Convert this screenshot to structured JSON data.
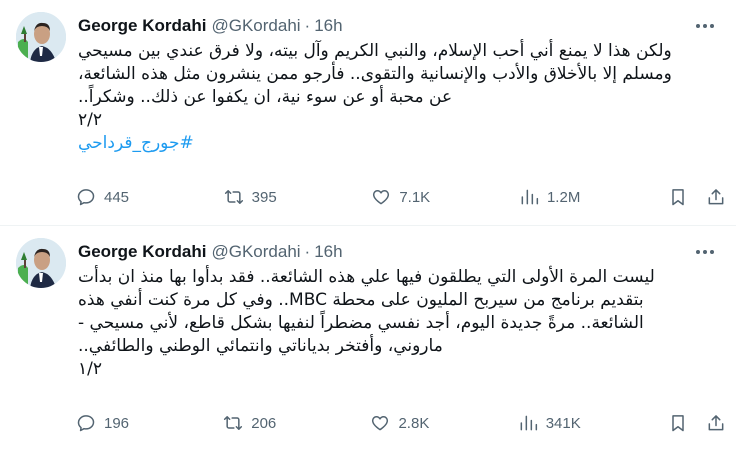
{
  "tweets": [
    {
      "author": {
        "name": "George Kordahi",
        "handle": "@GKordahi",
        "separator": "·",
        "time": "16h"
      },
      "lines": [
        "ولكن هذا لا يمنع أني أحب الإسلام، والنبي الكريم وآل بيته، ولا فرق عندي بين مسيحي",
        "ومسلم إلا بالأخلاق والأدب والإنسانية والتقوى.. فأرجو ممن ينشرون مثل هذه الشائعة،",
        "عن محبة أو عن سوء نية، ان يكفوا عن ذلك.. وشكراً..",
        "٢/٢"
      ],
      "hashtag": "#جورج_قرداحي",
      "stats": {
        "replies": "445",
        "retweets": "395",
        "likes": "7.1K",
        "views": "1.2M"
      }
    },
    {
      "author": {
        "name": "George Kordahi",
        "handle": "@GKordahi",
        "separator": "·",
        "time": "16h"
      },
      "lines": [
        "ليست المرة الأولى التي يطلقون فيها علي هذه الشائعة.. فقد بدأوا بها منذ ان بدأت",
        "بتقديم برنامج من سيربح المليون على محطة MBC.. وفي كل مرة كنت أنفي هذه",
        "الشائعة.. مرةً جديدة اليوم، أجد نفسي مضطراً لنفيها بشكل قاطع، لأني مسيحي -",
        "ماروني، وأفتخر بدياناتي وانتمائي الوطني والطائفي..",
        "١/٢"
      ],
      "stats": {
        "replies": "196",
        "retweets": "206",
        "likes": "2.8K",
        "views": "341K"
      }
    }
  ]
}
